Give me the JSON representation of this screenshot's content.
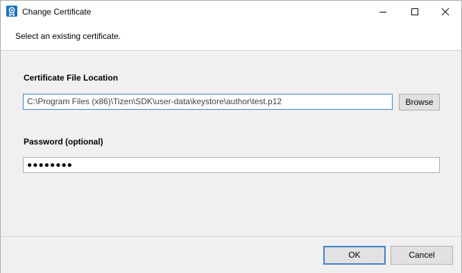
{
  "window": {
    "title": "Change Certificate",
    "icon": "certificate-icon",
    "controls": {
      "minimize_icon": "minimize-icon",
      "maximize_icon": "maximize-icon",
      "close_icon": "close-icon"
    }
  },
  "header": {
    "subtitle": "Select an existing certificate."
  },
  "form": {
    "certificate": {
      "label": "Certificate File Location",
      "value": "C:\\Program Files (x86)\\Tizen\\SDK\\user-data\\keystore\\author\\test.p12",
      "browse_label": "Browse"
    },
    "password": {
      "label": "Password (optional)",
      "masked_value": "●●●●●●●●"
    }
  },
  "footer": {
    "ok_label": "OK",
    "cancel_label": "Cancel"
  },
  "colors": {
    "accent": "#3c82c8",
    "panel_background": "#f0f0f0",
    "button_background": "#e1e1e1"
  }
}
